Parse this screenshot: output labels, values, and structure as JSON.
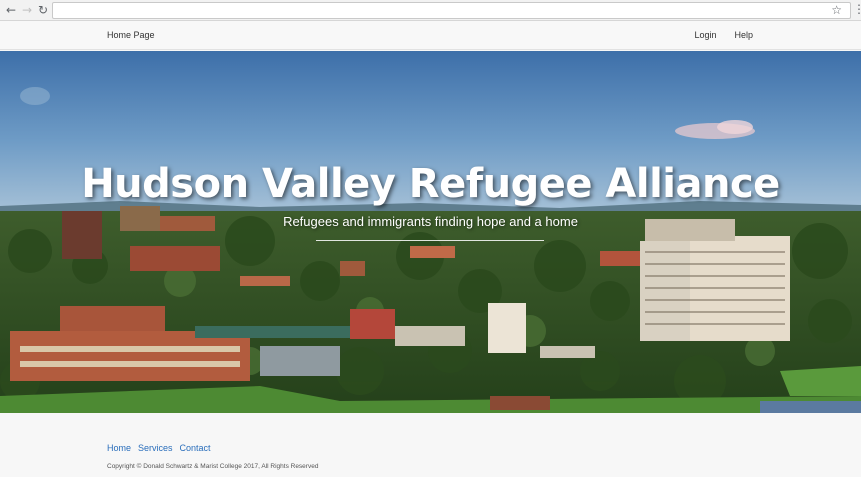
{
  "browser": {
    "address_value": "",
    "back_icon": "back-arrow-icon",
    "forward_icon": "forward-arrow-icon",
    "reload_icon": "reload-icon",
    "bookmark_icon": "star-icon",
    "menu_icon": "kebab-menu-icon"
  },
  "navbar": {
    "brand": "Home Page",
    "links": [
      {
        "label": "Login"
      },
      {
        "label": "Help"
      }
    ]
  },
  "hero": {
    "title": "Hudson Valley Refugee Alliance",
    "subtitle": "Refugees and immigrants finding hope and a home",
    "background": "aerial-city-photo"
  },
  "footer": {
    "links": [
      {
        "label": "Home"
      },
      {
        "label": "Services"
      },
      {
        "label": "Contact"
      }
    ],
    "copyright": "Copyright © Donald Schwartz & Marist College 2017, All Rights Reserved"
  },
  "colors": {
    "link": "#2a6ebb",
    "sky_top": "#3c6fa8",
    "trees": "#2f4f22"
  }
}
